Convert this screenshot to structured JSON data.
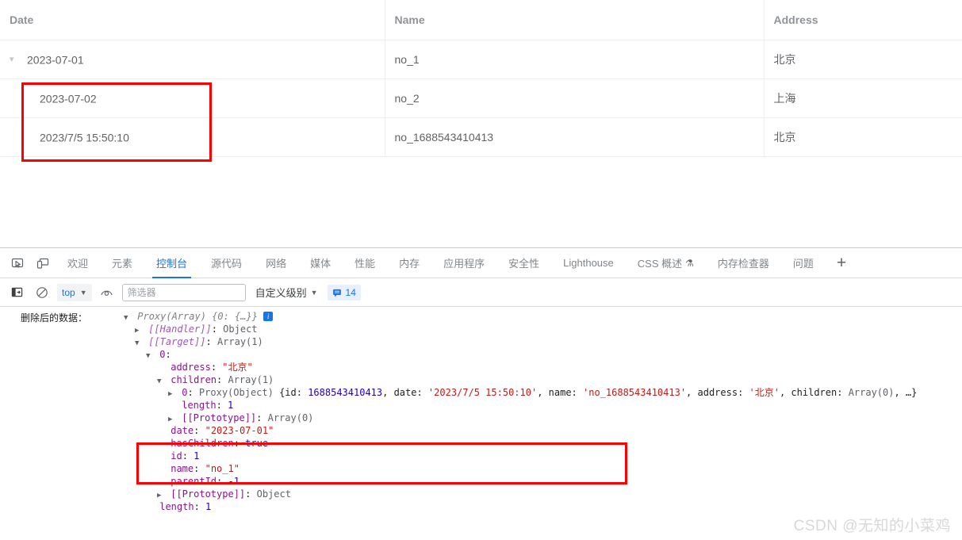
{
  "table": {
    "columns": [
      "Date",
      "Name",
      "Address"
    ],
    "rows": [
      {
        "date": "2023-07-01",
        "name": "no_1",
        "address": "北京",
        "expanded": true,
        "level": 0,
        "toggle": "chevron-down-icon"
      },
      {
        "date": "2023-07-02",
        "name": "no_2",
        "address": "上海",
        "expanded": false,
        "level": 1,
        "toggle": ""
      },
      {
        "date": "2023/7/5 15:50:10",
        "name": "no_1688543410413",
        "address": "北京",
        "expanded": false,
        "level": 1,
        "toggle": ""
      }
    ],
    "highlight_color": "#fe0000"
  },
  "devtools": {
    "left_icons": [
      {
        "name": "inspect-element-icon",
        "title": "检查元素"
      },
      {
        "name": "device-toolbar-icon",
        "title": "设备工具栏"
      }
    ],
    "tabs": [
      {
        "label": "欢迎",
        "active": false
      },
      {
        "label": "元素",
        "active": false
      },
      {
        "label": "控制台",
        "active": true
      },
      {
        "label": "源代码",
        "active": false
      },
      {
        "label": "网络",
        "active": false
      },
      {
        "label": "媒体",
        "active": false
      },
      {
        "label": "性能",
        "active": false
      },
      {
        "label": "内存",
        "active": false
      },
      {
        "label": "应用程序",
        "active": false
      },
      {
        "label": "安全性",
        "active": false
      },
      {
        "label": "Lighthouse",
        "active": false
      },
      {
        "label": "CSS 概述",
        "active": false,
        "suffix": "⚗"
      },
      {
        "label": "内存检查器",
        "active": false
      },
      {
        "label": "问题",
        "active": false
      }
    ],
    "add_tab_label": "+",
    "active_accent": "#1a73e8",
    "toolbar": {
      "sidebar_toggle": "console-sidebar-icon",
      "clear_label": "clear-console-icon",
      "context": "top",
      "eye_icon": "live-expression-icon",
      "filter_placeholder": "筛选器",
      "filter_value": "",
      "level_label": "自定义级别",
      "issues_count": "14",
      "issues_icon": "issues-icon"
    }
  },
  "console": {
    "log_label": "删除后的数据：",
    "lines": [
      {
        "indent": 0,
        "toggle": "open",
        "segments": [
          {
            "t": "Proxy(Array) {0: {…}}",
            "c": "prev"
          },
          {
            "t": " ",
            "c": "plain"
          }
        ],
        "badge": true
      },
      {
        "indent": 1,
        "toggle": "closed",
        "segments": [
          {
            "t": "[[Handler]]",
            "c": "k-intern"
          },
          {
            "t": ": ",
            "c": "plain"
          },
          {
            "t": "Object",
            "c": "v-obj"
          }
        ]
      },
      {
        "indent": 1,
        "toggle": "open",
        "segments": [
          {
            "t": "[[Target]]",
            "c": "k-intern"
          },
          {
            "t": ": ",
            "c": "plain"
          },
          {
            "t": "Array(1)",
            "c": "v-obj"
          }
        ]
      },
      {
        "indent": 2,
        "toggle": "open",
        "segments": [
          {
            "t": "0",
            "c": "k-prop"
          },
          {
            "t": ":",
            "c": "plain"
          }
        ]
      },
      {
        "indent": 3,
        "toggle": "none",
        "segments": [
          {
            "t": "address",
            "c": "k-prop"
          },
          {
            "t": ": ",
            "c": "plain"
          },
          {
            "t": "\"北京\"",
            "c": "v-str"
          }
        ]
      },
      {
        "indent": 3,
        "toggle": "open",
        "segments": [
          {
            "t": "children",
            "c": "k-prop"
          },
          {
            "t": ": ",
            "c": "plain"
          },
          {
            "t": "Array(1)",
            "c": "v-obj"
          }
        ]
      },
      {
        "indent": 4,
        "toggle": "closed",
        "segments": [
          {
            "t": "0",
            "c": "k-prop"
          },
          {
            "t": ": ",
            "c": "plain"
          },
          {
            "t": "Proxy(Object) ",
            "c": "v-obj"
          },
          {
            "t": "{id: ",
            "c": "plain"
          },
          {
            "t": "1688543410413",
            "c": "v-num"
          },
          {
            "t": ", date: ",
            "c": "plain"
          },
          {
            "t": "'2023/7/5 15:50:10'",
            "c": "v-str"
          },
          {
            "t": ", name: ",
            "c": "plain"
          },
          {
            "t": "'no_1688543410413'",
            "c": "v-str"
          },
          {
            "t": ", address: ",
            "c": "plain"
          },
          {
            "t": "'北京'",
            "c": "v-str"
          },
          {
            "t": ", children: ",
            "c": "plain"
          },
          {
            "t": "Array(0)",
            "c": "v-obj"
          },
          {
            "t": ", …}",
            "c": "plain"
          }
        ]
      },
      {
        "indent": 4,
        "toggle": "none",
        "segments": [
          {
            "t": "length",
            "c": "k-prop"
          },
          {
            "t": ": ",
            "c": "plain"
          },
          {
            "t": "1",
            "c": "v-num"
          }
        ]
      },
      {
        "indent": 4,
        "toggle": "closed",
        "segments": [
          {
            "t": "[[Prototype]]",
            "c": "k-prop"
          },
          {
            "t": ": ",
            "c": "plain"
          },
          {
            "t": "Array(0)",
            "c": "v-obj"
          }
        ]
      },
      {
        "indent": 3,
        "toggle": "none",
        "segments": [
          {
            "t": "date",
            "c": "k-prop"
          },
          {
            "t": ": ",
            "c": "plain"
          },
          {
            "t": "\"2023-07-01\"",
            "c": "v-str"
          }
        ]
      },
      {
        "indent": 3,
        "toggle": "none",
        "segments": [
          {
            "t": "hasChildren",
            "c": "k-prop"
          },
          {
            "t": ": ",
            "c": "plain"
          },
          {
            "t": "true",
            "c": "v-bool"
          }
        ]
      },
      {
        "indent": 3,
        "toggle": "none",
        "segments": [
          {
            "t": "id",
            "c": "k-prop"
          },
          {
            "t": ": ",
            "c": "plain"
          },
          {
            "t": "1",
            "c": "v-num"
          }
        ]
      },
      {
        "indent": 3,
        "toggle": "none",
        "segments": [
          {
            "t": "name",
            "c": "k-prop"
          },
          {
            "t": ": ",
            "c": "plain"
          },
          {
            "t": "\"no_1\"",
            "c": "v-str"
          }
        ]
      },
      {
        "indent": 3,
        "toggle": "none",
        "segments": [
          {
            "t": "parentId",
            "c": "k-prop"
          },
          {
            "t": ": ",
            "c": "plain"
          },
          {
            "t": "-1",
            "c": "v-num"
          }
        ]
      },
      {
        "indent": 3,
        "toggle": "closed",
        "segments": [
          {
            "t": "[[Prototype]]",
            "c": "k-prop"
          },
          {
            "t": ": ",
            "c": "plain"
          },
          {
            "t": "Object",
            "c": "v-obj"
          }
        ]
      },
      {
        "indent": 2,
        "toggle": "none",
        "segments": [
          {
            "t": "length",
            "c": "k-prop"
          },
          {
            "t": ": ",
            "c": "plain"
          },
          {
            "t": "1",
            "c": "v-num"
          }
        ]
      }
    ]
  },
  "watermark": {
    "text": "CSDN @无知的小菜鸡"
  }
}
